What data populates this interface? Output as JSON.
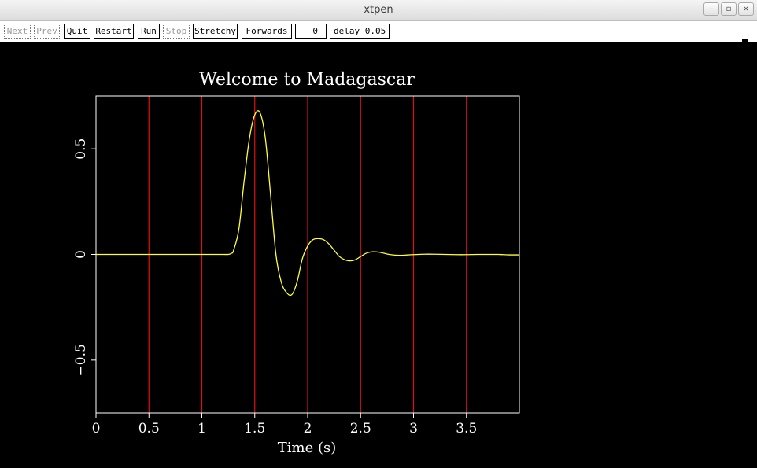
{
  "window": {
    "title": "xtpen",
    "minimize_glyph": "–",
    "maximize_glyph": "▫",
    "close_glyph": "×"
  },
  "toolbar": {
    "next_label": "Next",
    "prev_label": "Prev",
    "quit_label": "Quit",
    "restart_label": "Restart",
    "run_label": "Run",
    "stop_label": "Stop",
    "stretchy_label": "Stretchy",
    "direction_label": "Forwards",
    "frame_value": "0",
    "delay_label": "delay 0.05"
  },
  "colors": {
    "background": "#000000",
    "axes": "#ffffff",
    "gridlines": "#e01010",
    "trace": "#ffff33"
  },
  "chart_data": {
    "type": "line",
    "title": "Welcome to Madagascar",
    "xlabel": "Time (s)",
    "ylabel": "",
    "xlim": [
      0,
      4
    ],
    "ylim": [
      -0.75,
      0.75
    ],
    "xticks": [
      0,
      0.5,
      1,
      1.5,
      2,
      2.5,
      3,
      3.5
    ],
    "xtick_labels": [
      "0",
      "0.5",
      "1",
      "1.5",
      "2",
      "2.5",
      "3",
      "3.5"
    ],
    "yticks": [
      0.5,
      0,
      -0.5
    ],
    "ytick_labels": [
      "0.5",
      "0",
      "−0.5"
    ],
    "vertical_gridlines_at": [
      0.5,
      1,
      1.5,
      2,
      2.5,
      3,
      3.5
    ],
    "series": [
      {
        "x": [
          0,
          0.5,
          1.0,
          1.2,
          1.25,
          1.28,
          1.3,
          1.35,
          1.4,
          1.45,
          1.5,
          1.55,
          1.6,
          1.65,
          1.7,
          1.75,
          1.8,
          1.85,
          1.9,
          1.95,
          2.0,
          2.05,
          2.1,
          2.15,
          2.2,
          2.25,
          2.3,
          2.35,
          2.4,
          2.45,
          2.5,
          2.55,
          2.6,
          2.65,
          2.7,
          2.75,
          2.8,
          2.85,
          2.9,
          2.95,
          3.0,
          3.1,
          3.2,
          3.3,
          3.4,
          3.5,
          3.6,
          3.7,
          3.8,
          3.9,
          4.0
        ],
        "y": [
          0,
          0,
          0,
          0,
          0.0,
          0.005,
          0.02,
          0.12,
          0.35,
          0.55,
          0.66,
          0.67,
          0.55,
          0.28,
          0.0,
          -0.13,
          -0.18,
          -0.19,
          -0.13,
          -0.02,
          0.04,
          0.07,
          0.075,
          0.07,
          0.05,
          0.02,
          -0.01,
          -0.025,
          -0.03,
          -0.025,
          -0.01,
          0.005,
          0.012,
          0.012,
          0.008,
          0.002,
          -0.002,
          -0.004,
          -0.004,
          -0.002,
          -0.001,
          0.001,
          0.001,
          0.0,
          -0.001,
          -0.001,
          0.0,
          0.0,
          0.0,
          -0.002,
          -0.002
        ]
      }
    ]
  }
}
